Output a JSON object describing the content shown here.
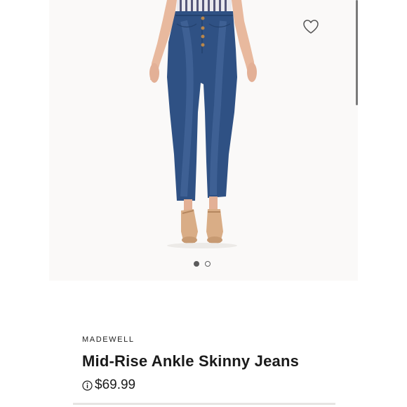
{
  "product": {
    "brand": "MADEWELL",
    "name": "Mid-Rise Ankle Skinny Jeans",
    "price": "$69.99",
    "image_alt": "Model wearing blue high-rise skinny jeans with button fly and tan heeled sandals"
  },
  "carousel": {
    "total_images": 2,
    "active_index": 0
  },
  "icons": {
    "favorite": "heart-outline-icon",
    "price_info": "info-circle-icon"
  },
  "colors": {
    "denim": "#2f5184",
    "price_text": "#1a1a1a",
    "dot_active": "#5c5c5c"
  }
}
